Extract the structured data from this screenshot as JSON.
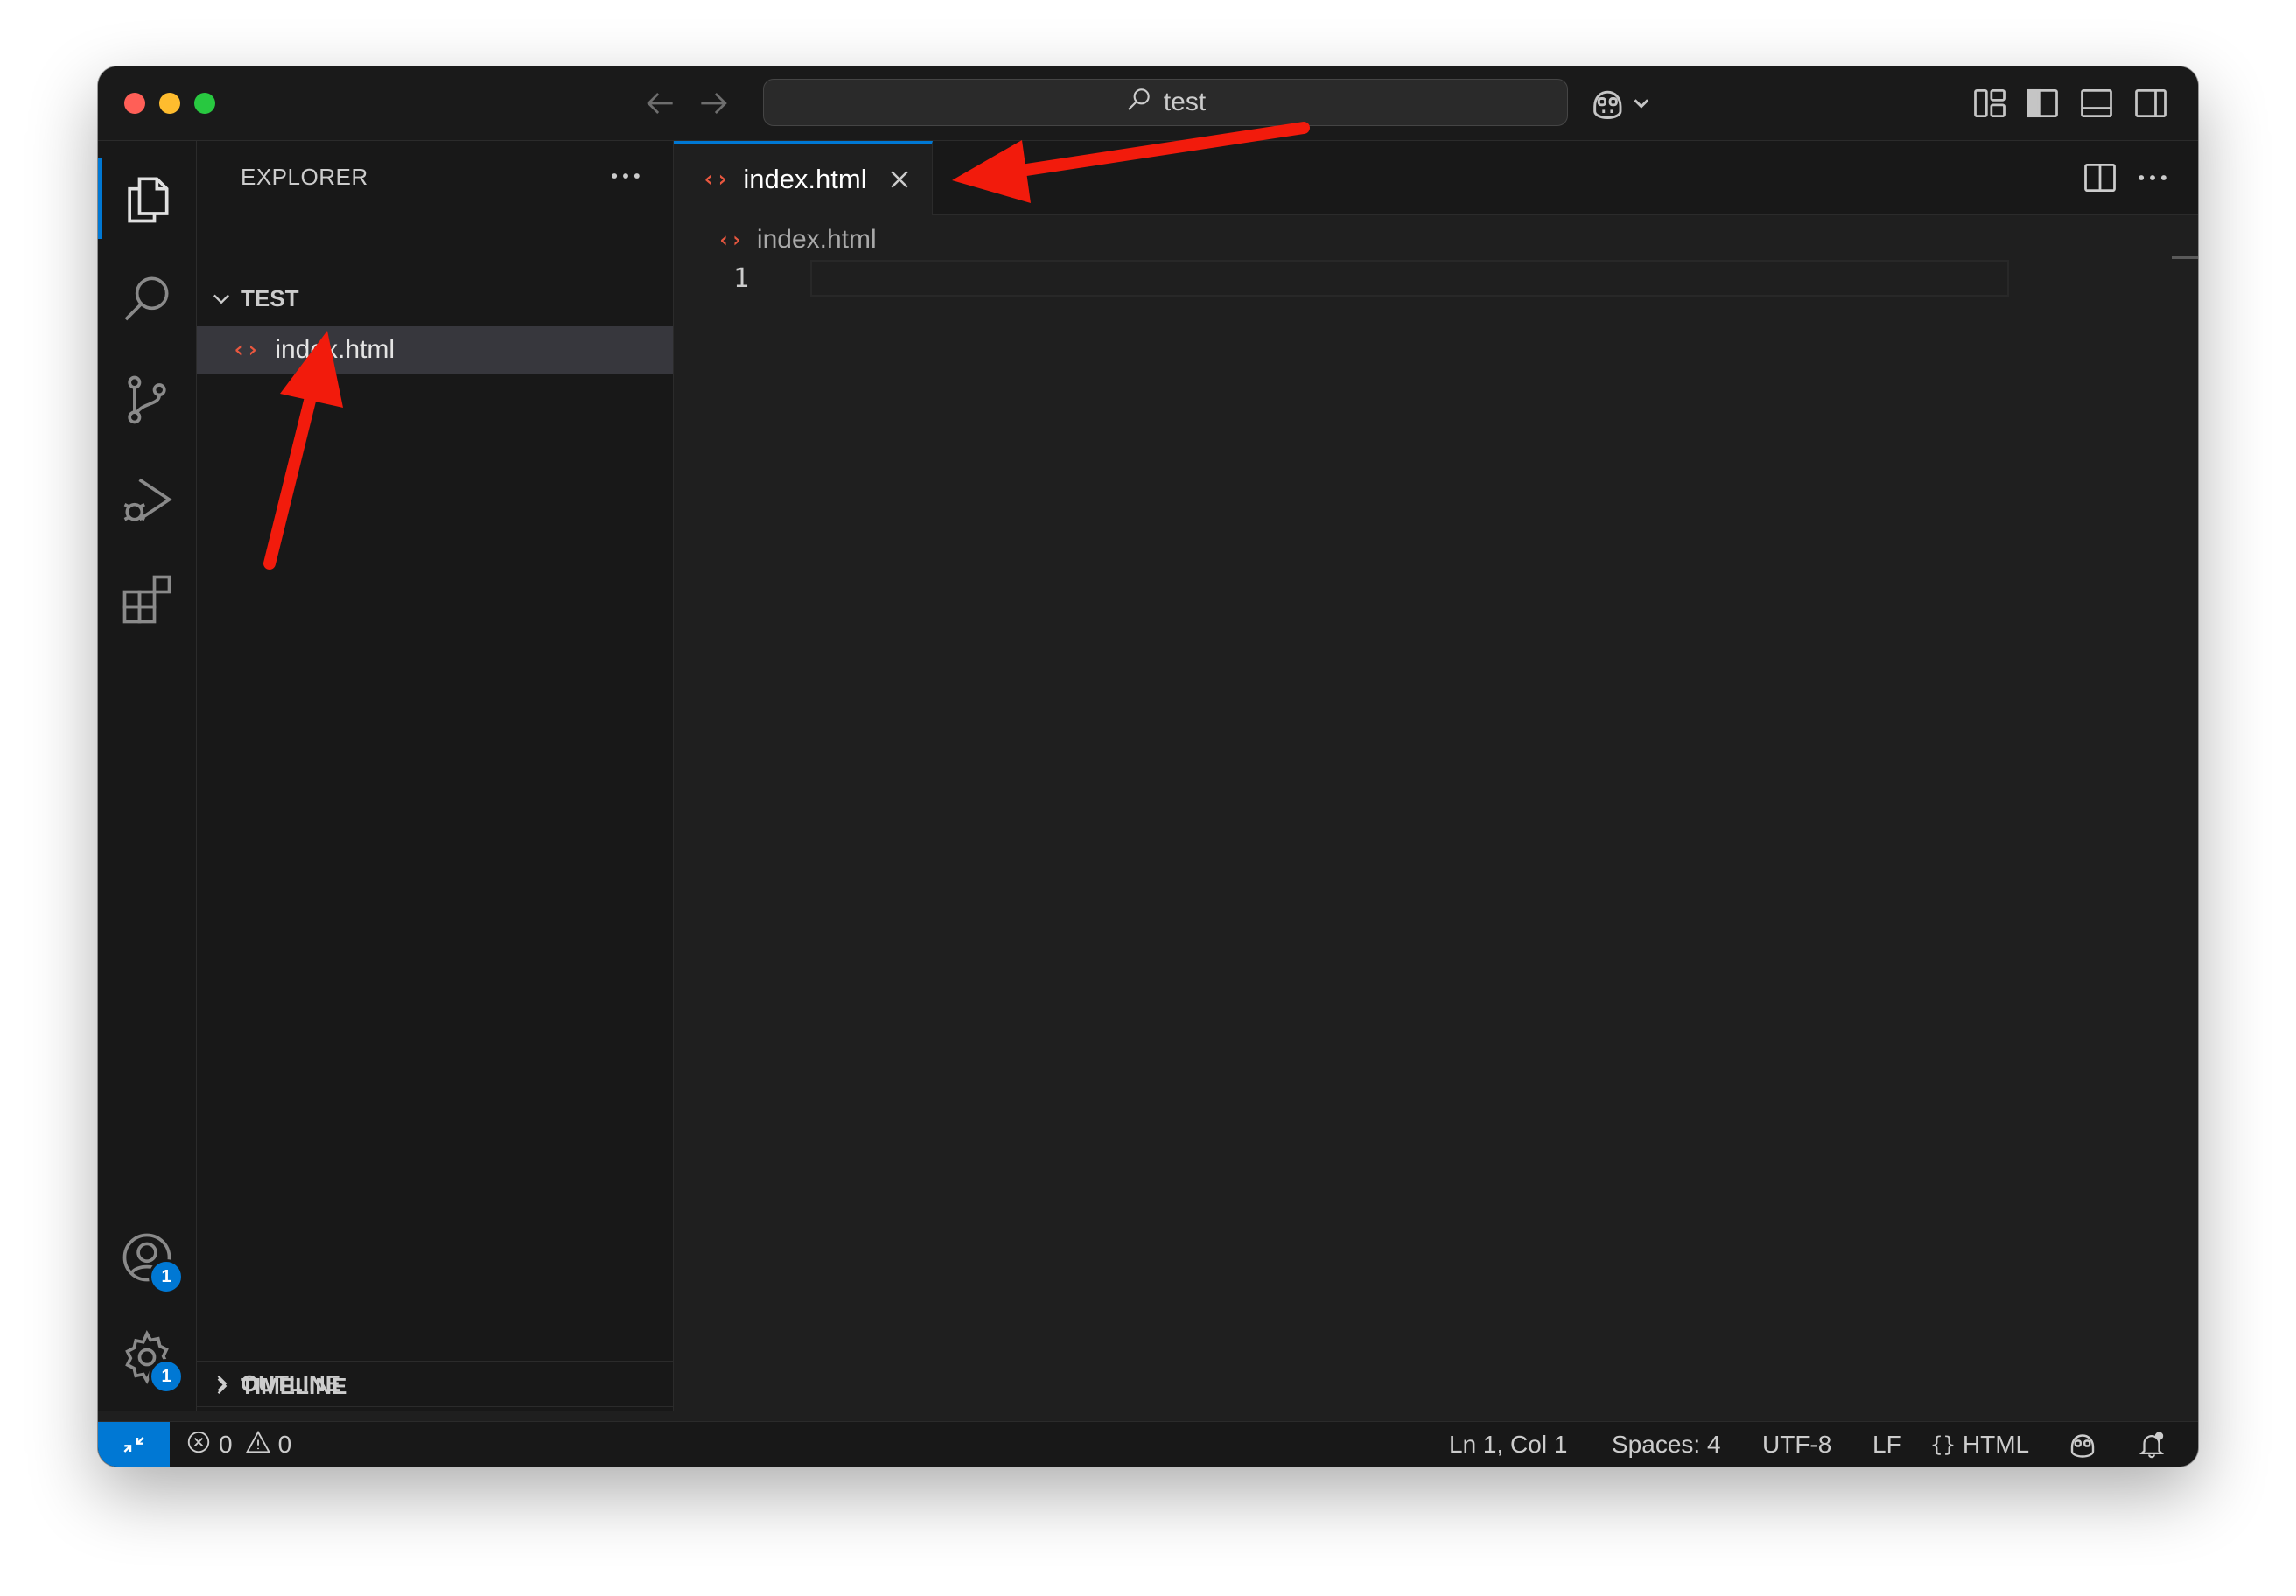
{
  "window": {
    "command_center": {
      "text": "test"
    }
  },
  "sidebar": {
    "title": "EXPLORER",
    "folder": "TEST",
    "files": [
      {
        "name": "index.html",
        "icon": "html-file-icon"
      }
    ],
    "sections": [
      {
        "label": "OUTLINE"
      },
      {
        "label": "TIMELINE"
      }
    ]
  },
  "activity_bar": {
    "items": [
      "files-icon",
      "search-icon",
      "source-control-icon",
      "run-debug-icon",
      "extensions-icon"
    ],
    "accounts_badge": "1",
    "settings_badge": "1"
  },
  "editor": {
    "tab": {
      "label": "index.html"
    },
    "breadcrumb": "index.html",
    "line_numbers": [
      "1"
    ]
  },
  "statusbar": {
    "errors": "0",
    "warnings": "0",
    "position": "Ln 1, Col 1",
    "spaces": "Spaces: 4",
    "encoding": "UTF-8",
    "eol": "LF",
    "language": "HTML"
  },
  "colors": {
    "accent": "#0078d4",
    "html_icon": "#e8573f",
    "annotation_arrow": "#f21b0c"
  }
}
